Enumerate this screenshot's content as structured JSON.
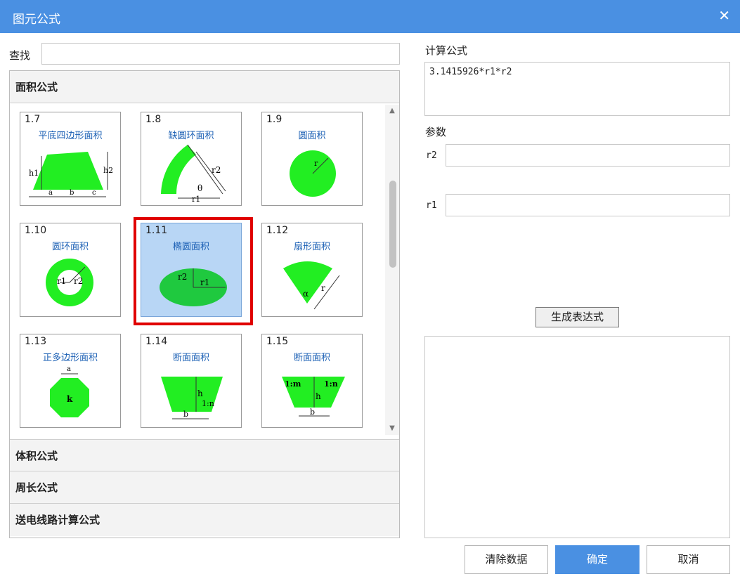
{
  "window": {
    "title": "图元公式",
    "close_glyph": "✕"
  },
  "search": {
    "label": "查找",
    "value": ""
  },
  "accordion": {
    "sections": [
      {
        "label": "面积公式",
        "expanded": true
      },
      {
        "label": "体积公式",
        "expanded": false
      },
      {
        "label": "周长公式",
        "expanded": false
      },
      {
        "label": "送电线路计算公式",
        "expanded": false
      }
    ],
    "tiles": [
      {
        "num": "1.7",
        "name": "平底四边形面积",
        "icon": "trapezoid-area-icon",
        "labels": [
          "h1",
          "h2",
          "a",
          "b",
          "c"
        ]
      },
      {
        "num": "1.8",
        "name": "缺圆环面积",
        "icon": "partial-ring-area-icon",
        "labels": [
          "r2",
          "θ",
          "r1"
        ]
      },
      {
        "num": "1.9",
        "name": "圆面积",
        "icon": "circle-area-icon",
        "labels": [
          "r"
        ]
      },
      {
        "num": "1.10",
        "name": "圆环面积",
        "icon": "ring-area-icon",
        "labels": [
          "r1",
          "r2"
        ]
      },
      {
        "num": "1.11",
        "name": "椭圆面积",
        "icon": "ellipse-area-icon",
        "labels": [
          "r2",
          "r1"
        ],
        "selected": true
      },
      {
        "num": "1.12",
        "name": "扇形面积",
        "icon": "sector-area-icon",
        "labels": [
          "α",
          "r"
        ]
      },
      {
        "num": "1.13",
        "name": "正多边形面积",
        "icon": "regular-polygon-area-icon",
        "labels": [
          "a",
          "k"
        ]
      },
      {
        "num": "1.14",
        "name": "断面面积",
        "icon": "section-area-icon",
        "labels": [
          "h",
          "1:n",
          "b"
        ]
      },
      {
        "num": "1.15",
        "name": "断面面积",
        "icon": "section-area-2-icon",
        "labels": [
          "1:m",
          "1:n",
          "h",
          "b"
        ]
      }
    ]
  },
  "formula": {
    "label": "计算公式",
    "value": "3.1415926*r1*r2"
  },
  "params": {
    "label": "参数",
    "items": [
      {
        "name": "r2",
        "value": ""
      },
      {
        "name": "r1",
        "value": ""
      }
    ]
  },
  "generate_button": "生成表达式",
  "expression_output": "",
  "buttons": {
    "clear": "清除数据",
    "ok": "确定",
    "cancel": "取消"
  },
  "colors": {
    "titlebar": "#4a90e2",
    "shape_fill": "#22ee22",
    "selection": "#e00000",
    "tile_selected": "#b8d6f5",
    "link_text": "#1a5fb4"
  }
}
